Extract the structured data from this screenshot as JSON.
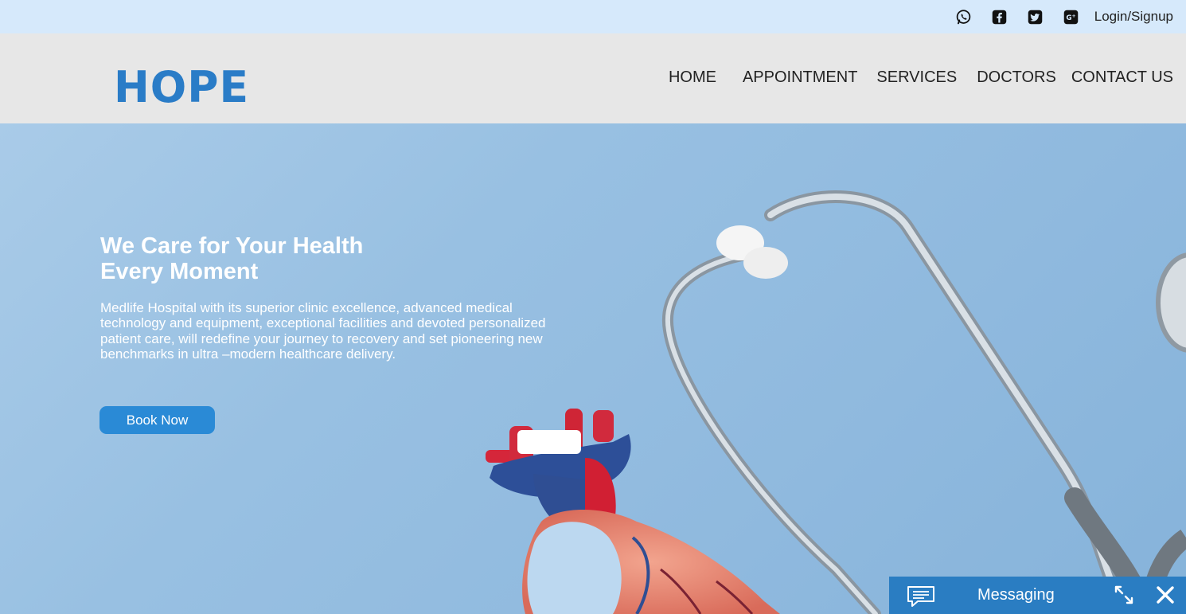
{
  "topbar": {
    "social_icons": [
      "whatsapp-icon",
      "facebook-icon",
      "twitter-icon",
      "google-plus-icon"
    ],
    "login_label": "Login/Signup"
  },
  "header": {
    "logo_text": "HOPE",
    "nav": [
      {
        "label": "HOME"
      },
      {
        "label": "APPOINTMENT"
      },
      {
        "label": "SERVICES"
      },
      {
        "label": "DOCTORS"
      },
      {
        "label": "CONTACT US"
      }
    ]
  },
  "hero": {
    "title_line1": "We Care for Your Health",
    "title_line2": "Every Moment",
    "description": "Medlife Hospital with its superior clinic excellence, advanced medical technology and equipment, exceptional facilities and devoted personalized patient care, will redefine your journey to recovery and set pioneering new benchmarks in ultra –modern healthcare delivery.",
    "button_label": "Book Now"
  },
  "messaging": {
    "label": "Messaging",
    "icons": [
      "chat-icon",
      "expand-icon",
      "close-icon"
    ]
  },
  "colors": {
    "topbar_bg": "#d6e9fb",
    "header_bg": "#e7e7e7",
    "brand_blue": "#2a7cc7",
    "hero_bg": "#98c0e2",
    "button_bg": "#2a8ad6",
    "messaging_bg": "#2a7dc2"
  }
}
